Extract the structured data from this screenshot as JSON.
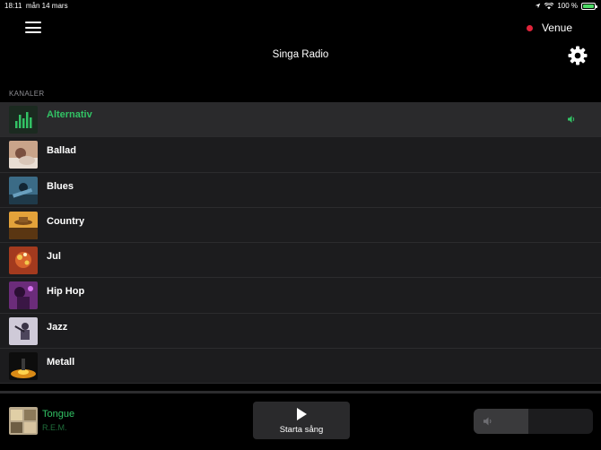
{
  "status_bar": {
    "time": "18:11",
    "date": "mån 14 mars",
    "battery": "100 %",
    "battery_level": 1.0
  },
  "header": {
    "venue_label": "Venue",
    "venue_dot_color": "#e0243a",
    "title": "Singa Radio"
  },
  "channels": {
    "section_label": "KANALER",
    "items": [
      {
        "label": "Alternativ",
        "active": true
      },
      {
        "label": "Ballad"
      },
      {
        "label": "Blues"
      },
      {
        "label": "Country"
      },
      {
        "label": "Jul"
      },
      {
        "label": "Hip Hop"
      },
      {
        "label": "Jazz"
      },
      {
        "label": "Metall"
      }
    ]
  },
  "now_playing": {
    "title": "Tongue",
    "artist": "R.E.M."
  },
  "player": {
    "play_label": "Starta sång",
    "volume_level": 0.46
  },
  "colors": {
    "accent_green": "#32c365",
    "row_bg": "#1c1c1e",
    "active_row_bg": "#2a2a2c"
  }
}
